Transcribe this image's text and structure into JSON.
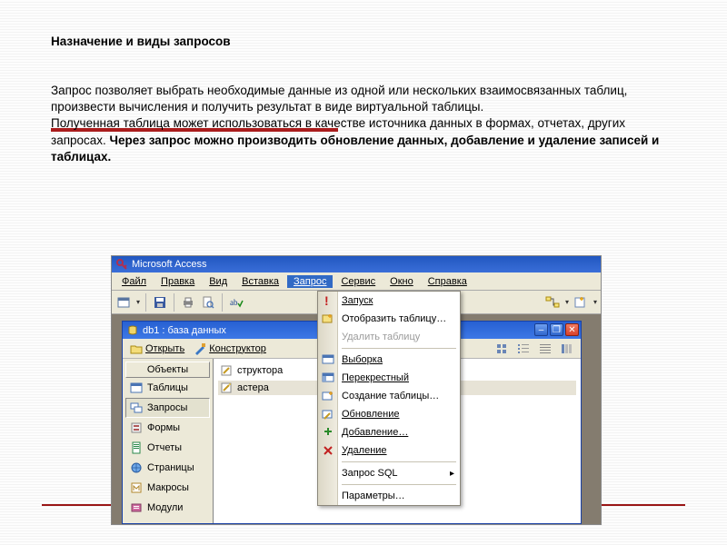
{
  "slide": {
    "title": "Назначение и виды запросов",
    "p1": "Запрос позволяет выбрать необходимые данные из одной или нескольких взаимосвязанных таблиц, произвести вычисления и получить результат в виде виртуальной таблицы.",
    "p2a": "Полученная таблица может использоваться в качестве источника данных в формах, отчетах, других запросах. ",
    "p2b": "Через запрос можно производить обновление данных, добавление и удаление записей и таблицах."
  },
  "app": {
    "title": "Microsoft Access",
    "menu": {
      "file": "Файл",
      "edit": "Правка",
      "view": "Вид",
      "insert": "Вставка",
      "query": "Запрос",
      "service": "Сервис",
      "window": "Окно",
      "help": "Справка"
    },
    "toolbar_text_items": {
      "question_hint": "?"
    },
    "inner": {
      "title": "db1 : база данных",
      "open": "Открыть",
      "design": "Конструктор",
      "objects_header": "Объекты",
      "objects": {
        "tables": "Таблицы",
        "queries": "Запросы",
        "forms": "Формы",
        "reports": "Отчеты",
        "pages": "Страницы",
        "macros": "Макросы",
        "modules": "Модули"
      },
      "list": {
        "by_design": "Создание запроса в режиме конструктора",
        "by_wizard": "Создание запроса с помощью мастера",
        "vis1": "cтруктора",
        "vis2": "aстера"
      }
    },
    "popup": {
      "run": "Запуск",
      "show_table": "Отобразить таблицу…",
      "delete_table": "Удалить таблицу",
      "select": "Выборка",
      "crosstab": "Перекрестный",
      "maketable": "Создание таблицы…",
      "update": "Обновление",
      "append": "Добавление…",
      "delete": "Удаление",
      "sql": "Запрос SQL",
      "params": "Параметры…"
    }
  },
  "colors": {
    "titlebar": "#2a5fca",
    "accent": "#9a1616"
  }
}
